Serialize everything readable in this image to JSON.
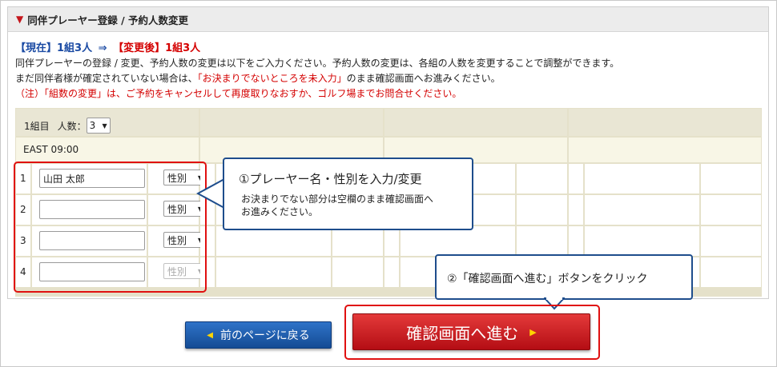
{
  "header": {
    "title": "同伴プレーヤー登録 / 予約人数変更"
  },
  "info": {
    "current_label": "【現在】",
    "current_value": "1組3人",
    "arrow": "⇒",
    "change_label": "【変更後】",
    "change_value": "1組3人",
    "line1": "同伴プレーヤーの登録 / 変更、予約人数の変更は以下をご入力ください。予約人数の変更は、各組の人数を変更することで調整ができます。",
    "line2_pre": "まだ同伴者様が確定されていない場合は、",
    "line2_red": "「お決まりでないところを未入力」",
    "line2_post": "のまま確認画面へお進みください。",
    "line3": "（注）「組数の変更」は、ご予約をキャンセルして再度取りなおすか、ゴルフ場までお問合せください。"
  },
  "group": {
    "label": "1組目",
    "count_label": "人数：",
    "count_value": "3",
    "tee": "EAST 09:00"
  },
  "players": [
    {
      "num": "1",
      "name": "山田 太郎",
      "gender": "性別",
      "disabled": false
    },
    {
      "num": "2",
      "name": "",
      "gender": "性別",
      "disabled": false
    },
    {
      "num": "3",
      "name": "",
      "gender": "性別",
      "disabled": false
    },
    {
      "num": "4",
      "name": "",
      "gender": "性別",
      "disabled": true
    }
  ],
  "callout1": {
    "title": "①プレーヤー名・性別を入力/変更",
    "body_line1": "お決まりでない部分は空欄のまま確認画面へ",
    "body_line2": "お進みください。"
  },
  "callout2": {
    "text": "②「確認画面へ進む」ボタンをクリック"
  },
  "buttons": {
    "prev_arrow": "◀",
    "prev": "前のページに戻る",
    "next": "確認画面へ進む",
    "next_arrow": "▶"
  },
  "colors": {
    "accent_red": "#d40000",
    "accent_blue": "#1a4aa3",
    "button_blue": "#144b94",
    "button_red": "#b40d14",
    "table_header": "#e9e6d4"
  }
}
